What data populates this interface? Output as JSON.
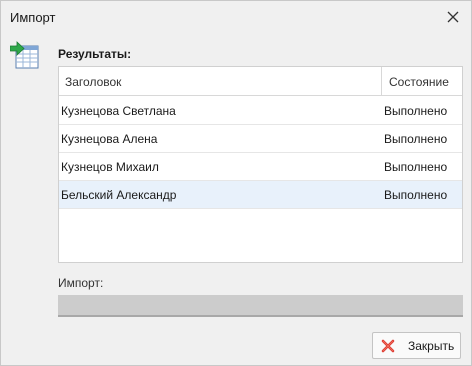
{
  "window": {
    "title": "Импорт",
    "close_icon": "close-icon",
    "header_icon": "import-table-icon"
  },
  "results": {
    "label": "Результаты:",
    "columns": [
      "Заголовок",
      "Состояние"
    ],
    "rows": [
      {
        "title": "Кузнецова Светлана",
        "status": "Выполнено"
      },
      {
        "title": "Кузнецова Алена",
        "status": "Выполнено"
      },
      {
        "title": "Кузнецов Михаил",
        "status": "Выполнено"
      },
      {
        "title": "Бельский Александр",
        "status": "Выполнено"
      }
    ],
    "selected_row": 3
  },
  "progress": {
    "label": "Импорт:",
    "fraction": 0
  },
  "footer": {
    "close_label": "Закрыть",
    "close_icon": "red-x-icon"
  },
  "colors": {
    "selected_row": "#e8f1fb",
    "close_icon_red": "#d9342b",
    "icon_green": "#2ea84a",
    "icon_blue": "#3a7bd5"
  }
}
